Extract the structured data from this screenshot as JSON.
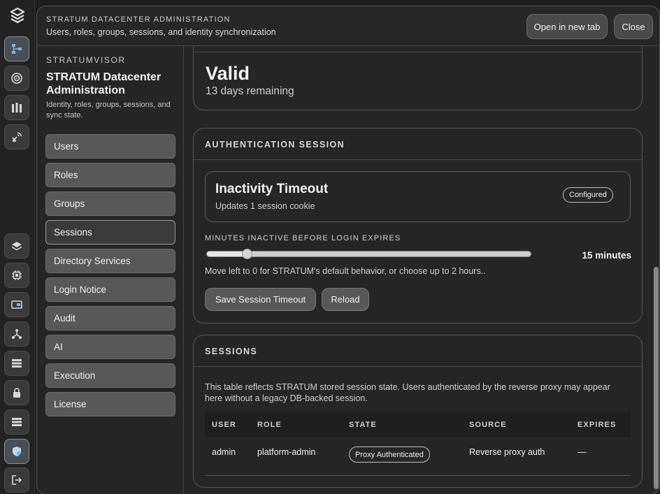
{
  "header": {
    "kicker": "STRATUM DATACENTER ADMINISTRATION",
    "subtitle": "Users, roles, groups, sessions, and identity synchronization",
    "open_new_tab": "Open in new tab",
    "close": "Close"
  },
  "rail": {
    "icons": [
      "logo-icon",
      "topology-icon",
      "target-icon",
      "racks-icon",
      "satellite-icon",
      "layers-icon",
      "chip-icon",
      "storage-card-icon",
      "network-icon",
      "server-list-icon",
      "lock-icon",
      "server-stack-icon",
      "admin-shield-icon",
      "logout-icon"
    ]
  },
  "sidebar": {
    "kicker": "STRATUMVISOR",
    "title": "STRATUM Datacenter Administration",
    "description": "Identity, roles, groups, sessions, and sync state.",
    "items": [
      {
        "label": "Users"
      },
      {
        "label": "Roles"
      },
      {
        "label": "Groups"
      },
      {
        "label": "Sessions"
      },
      {
        "label": "Directory Services"
      },
      {
        "label": "Login Notice"
      },
      {
        "label": "Audit"
      },
      {
        "label": "AI"
      },
      {
        "label": "Execution"
      },
      {
        "label": "License"
      }
    ],
    "active": "Sessions"
  },
  "license_card": {
    "status": "Valid",
    "remaining": "13 days remaining"
  },
  "auth_session": {
    "title": "AUTHENTICATION SESSION",
    "inner_title": "Inactivity Timeout",
    "inner_sub": "Updates 1 session cookie",
    "badge": "Configured",
    "slider_label": "MINUTES INACTIVE BEFORE LOGIN EXPIRES",
    "slider_value": 15,
    "slider_max": 120,
    "slider_value_text": "15 minutes",
    "help": "Move left to 0 for STRATUM's default behavior, or choose up to 2 hours..",
    "save_label": "Save Session Timeout",
    "reload_label": "Reload"
  },
  "sessions": {
    "title": "SESSIONS",
    "description": "This table reflects STRATUM stored session state. Users authenticated by the reverse proxy may appear here without a legacy DB-backed session.",
    "columns": [
      "USER",
      "ROLE",
      "STATE",
      "SOURCE",
      "EXPIRES"
    ],
    "rows": [
      {
        "user": "admin",
        "role": "platform-admin",
        "state": "Proxy Authenticated",
        "source": "Reverse proxy auth",
        "expires": "—"
      }
    ]
  },
  "colors": {
    "background": "#1e1e1e",
    "panel": "#262626",
    "button": "#585858",
    "active_rail": "#4a4f55"
  }
}
